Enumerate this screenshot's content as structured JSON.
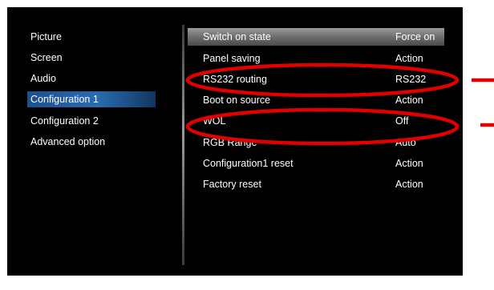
{
  "left_menu": {
    "items": [
      {
        "label": "Picture"
      },
      {
        "label": "Screen"
      },
      {
        "label": "Audio"
      },
      {
        "label": "Configuration 1"
      },
      {
        "label": "Configuration 2"
      },
      {
        "label": "Advanced option"
      }
    ]
  },
  "right_menu": {
    "items": [
      {
        "label": "Switch on state",
        "value": "Force on"
      },
      {
        "label": "Panel saving",
        "value": "Action"
      },
      {
        "label": "RS232 routing",
        "value": "RS232"
      },
      {
        "label": "Boot on source",
        "value": "Action"
      },
      {
        "label": "WOL",
        "value": "Off"
      },
      {
        "label": "RGB Range",
        "value": "Auto"
      },
      {
        "label": "Configuration1 reset",
        "value": "Action"
      },
      {
        "label": "Factory reset",
        "value": "Action"
      }
    ]
  },
  "colors": {
    "annotation": "#e00000",
    "selection_left": "#2a6bb0",
    "selection_right": "#7a7a7a"
  }
}
